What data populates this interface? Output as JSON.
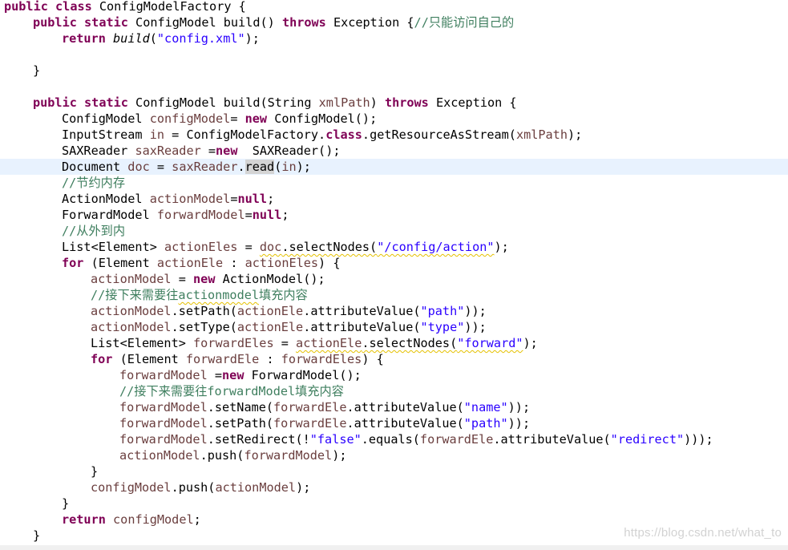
{
  "editor": {
    "colors": {
      "keyword": "#7f0055",
      "field": "#6a3e3e",
      "string": "#2a00ff",
      "comment": "#3f7f5f",
      "default": "#000000",
      "current_line": "#e8f2fe",
      "occurrence_highlight": "#d4d4d4",
      "warning_squiggle": "#e5c100"
    },
    "current_line_index": 10,
    "lines": [
      {
        "indent": 0,
        "tokens": [
          {
            "t": "public",
            "c": "kw"
          },
          {
            "t": " "
          },
          {
            "t": "class",
            "c": "kw"
          },
          {
            "t": " ConfigModelFactory {"
          }
        ]
      },
      {
        "indent": 1,
        "tokens": [
          {
            "t": "public",
            "c": "kw"
          },
          {
            "t": " "
          },
          {
            "t": "static",
            "c": "kw"
          },
          {
            "t": " ConfigModel build() "
          },
          {
            "t": "throws",
            "c": "kw"
          },
          {
            "t": " Exception {"
          },
          {
            "t": "//只能访问自己的",
            "c": "cmt"
          }
        ]
      },
      {
        "indent": 2,
        "tokens": [
          {
            "t": "return",
            "c": "kw"
          },
          {
            "t": " "
          },
          {
            "t": "build",
            "c": "it"
          },
          {
            "t": "("
          },
          {
            "t": "\"config.xml\"",
            "c": "str"
          },
          {
            "t": ");"
          }
        ]
      },
      {
        "indent": 0,
        "tokens": []
      },
      {
        "indent": 1,
        "tokens": [
          {
            "t": "}"
          }
        ]
      },
      {
        "indent": 0,
        "tokens": []
      },
      {
        "indent": 1,
        "tokens": [
          {
            "t": "public",
            "c": "kw"
          },
          {
            "t": " "
          },
          {
            "t": "static",
            "c": "kw"
          },
          {
            "t": " ConfigModel build(String "
          },
          {
            "t": "xmlPath",
            "c": "fld"
          },
          {
            "t": ") "
          },
          {
            "t": "throws",
            "c": "kw"
          },
          {
            "t": " Exception {"
          }
        ]
      },
      {
        "indent": 2,
        "tokens": [
          {
            "t": "ConfigModel "
          },
          {
            "t": "configModel",
            "c": "fld"
          },
          {
            "t": "= "
          },
          {
            "t": "new",
            "c": "kw"
          },
          {
            "t": " ConfigModel();"
          }
        ]
      },
      {
        "indent": 2,
        "tokens": [
          {
            "t": "InputStream "
          },
          {
            "t": "in",
            "c": "fld"
          },
          {
            "t": " = ConfigModelFactory."
          },
          {
            "t": "class",
            "c": "kw"
          },
          {
            "t": ".getResourceAsStream("
          },
          {
            "t": "xmlPath",
            "c": "fld"
          },
          {
            "t": ");"
          }
        ]
      },
      {
        "indent": 2,
        "tokens": [
          {
            "t": "SAXReader "
          },
          {
            "t": "saxReader",
            "c": "fld"
          },
          {
            "t": " ="
          },
          {
            "t": "new",
            "c": "kw"
          },
          {
            "t": "  SAXReader();"
          }
        ]
      },
      {
        "indent": 2,
        "tokens": [
          {
            "t": "Document "
          },
          {
            "t": "doc",
            "c": "fld"
          },
          {
            "t": " = "
          },
          {
            "t": "saxReader",
            "c": "fld"
          },
          {
            "t": "."
          },
          {
            "t": "read",
            "c": "occ"
          },
          {
            "t": "("
          },
          {
            "t": "in",
            "c": "fld"
          },
          {
            "t": ");"
          }
        ]
      },
      {
        "indent": 2,
        "tokens": [
          {
            "t": "//节约内存",
            "c": "cmt"
          }
        ]
      },
      {
        "indent": 2,
        "tokens": [
          {
            "t": "ActionModel "
          },
          {
            "t": "actionModel",
            "c": "fld"
          },
          {
            "t": "="
          },
          {
            "t": "null",
            "c": "kw"
          },
          {
            "t": ";"
          }
        ]
      },
      {
        "indent": 2,
        "tokens": [
          {
            "t": "ForwardModel "
          },
          {
            "t": "forwardModel",
            "c": "fld"
          },
          {
            "t": "="
          },
          {
            "t": "null",
            "c": "kw"
          },
          {
            "t": ";"
          }
        ]
      },
      {
        "indent": 2,
        "tokens": [
          {
            "t": "//从外到内",
            "c": "cmt"
          }
        ]
      },
      {
        "indent": 2,
        "tokens": [
          {
            "t": "List<Element> "
          },
          {
            "t": "actionEles",
            "c": "fld"
          },
          {
            "t": " = "
          },
          {
            "t": "doc",
            "c": "fld sq"
          },
          {
            "t": ".selectNodes(",
            "c": "sq"
          },
          {
            "t": "\"/config/action\"",
            "c": "str sq"
          },
          {
            "t": ");"
          }
        ]
      },
      {
        "indent": 2,
        "tokens": [
          {
            "t": "for",
            "c": "kw"
          },
          {
            "t": " (Element "
          },
          {
            "t": "actionEle",
            "c": "fld"
          },
          {
            "t": " : "
          },
          {
            "t": "actionEles",
            "c": "fld"
          },
          {
            "t": ") {"
          }
        ]
      },
      {
        "indent": 3,
        "tokens": [
          {
            "t": "actionModel",
            "c": "fld"
          },
          {
            "t": " = "
          },
          {
            "t": "new",
            "c": "kw"
          },
          {
            "t": " ActionModel();"
          }
        ]
      },
      {
        "indent": 3,
        "tokens": [
          {
            "t": "//接下来需要往",
            "c": "cmt"
          },
          {
            "t": "actionmodel",
            "c": "cmt sq"
          },
          {
            "t": "填充内容",
            "c": "cmt"
          }
        ]
      },
      {
        "indent": 3,
        "tokens": [
          {
            "t": "actionModel",
            "c": "fld"
          },
          {
            "t": ".setPath("
          },
          {
            "t": "actionEle",
            "c": "fld"
          },
          {
            "t": ".attributeValue("
          },
          {
            "t": "\"path\"",
            "c": "str"
          },
          {
            "t": "));"
          }
        ]
      },
      {
        "indent": 3,
        "tokens": [
          {
            "t": "actionModel",
            "c": "fld"
          },
          {
            "t": ".setType("
          },
          {
            "t": "actionEle",
            "c": "fld"
          },
          {
            "t": ".attributeValue("
          },
          {
            "t": "\"type\"",
            "c": "str"
          },
          {
            "t": "));"
          }
        ]
      },
      {
        "indent": 3,
        "tokens": [
          {
            "t": "List<Element> "
          },
          {
            "t": "forwardEles",
            "c": "fld"
          },
          {
            "t": " = "
          },
          {
            "t": "actionEle",
            "c": "fld sq"
          },
          {
            "t": ".selectNodes(",
            "c": "sq"
          },
          {
            "t": "\"forward\"",
            "c": "str sq"
          },
          {
            "t": ");"
          }
        ]
      },
      {
        "indent": 3,
        "tokens": [
          {
            "t": "for",
            "c": "kw"
          },
          {
            "t": " (Element "
          },
          {
            "t": "forwardEle",
            "c": "fld"
          },
          {
            "t": " : "
          },
          {
            "t": "forwardEles",
            "c": "fld"
          },
          {
            "t": ") {"
          }
        ]
      },
      {
        "indent": 4,
        "tokens": [
          {
            "t": "forwardModel",
            "c": "fld"
          },
          {
            "t": " ="
          },
          {
            "t": "new",
            "c": "kw"
          },
          {
            "t": " ForwardModel();"
          }
        ]
      },
      {
        "indent": 4,
        "tokens": [
          {
            "t": "//接下来需要往forwardModel填充内容",
            "c": "cmt"
          }
        ]
      },
      {
        "indent": 4,
        "tokens": [
          {
            "t": "forwardModel",
            "c": "fld"
          },
          {
            "t": ".setName("
          },
          {
            "t": "forwardEle",
            "c": "fld"
          },
          {
            "t": ".attributeValue("
          },
          {
            "t": "\"name\"",
            "c": "str"
          },
          {
            "t": "));"
          }
        ]
      },
      {
        "indent": 4,
        "tokens": [
          {
            "t": "forwardModel",
            "c": "fld"
          },
          {
            "t": ".setPath("
          },
          {
            "t": "forwardEle",
            "c": "fld"
          },
          {
            "t": ".attributeValue("
          },
          {
            "t": "\"path\"",
            "c": "str"
          },
          {
            "t": "));"
          }
        ]
      },
      {
        "indent": 4,
        "tokens": [
          {
            "t": "forwardModel",
            "c": "fld"
          },
          {
            "t": ".setRedirect(!"
          },
          {
            "t": "\"false\"",
            "c": "str"
          },
          {
            "t": ".equals("
          },
          {
            "t": "forwardEle",
            "c": "fld"
          },
          {
            "t": ".attributeValue("
          },
          {
            "t": "\"redirect\"",
            "c": "str"
          },
          {
            "t": ")));"
          }
        ]
      },
      {
        "indent": 4,
        "tokens": [
          {
            "t": "actionModel",
            "c": "fld"
          },
          {
            "t": ".push("
          },
          {
            "t": "forwardModel",
            "c": "fld"
          },
          {
            "t": ");"
          }
        ]
      },
      {
        "indent": 3,
        "tokens": [
          {
            "t": "}"
          }
        ]
      },
      {
        "indent": 3,
        "tokens": [
          {
            "t": "configModel",
            "c": "fld"
          },
          {
            "t": ".push("
          },
          {
            "t": "actionModel",
            "c": "fld"
          },
          {
            "t": ");"
          }
        ]
      },
      {
        "indent": 2,
        "tokens": [
          {
            "t": "}"
          }
        ]
      },
      {
        "indent": 2,
        "tokens": [
          {
            "t": "return",
            "c": "kw"
          },
          {
            "t": " "
          },
          {
            "t": "configModel",
            "c": "fld"
          },
          {
            "t": ";"
          }
        ]
      },
      {
        "indent": 1,
        "tokens": [
          {
            "t": "}"
          }
        ]
      }
    ]
  },
  "watermark": {
    "text": "https://blog.csdn.net/what_to"
  }
}
